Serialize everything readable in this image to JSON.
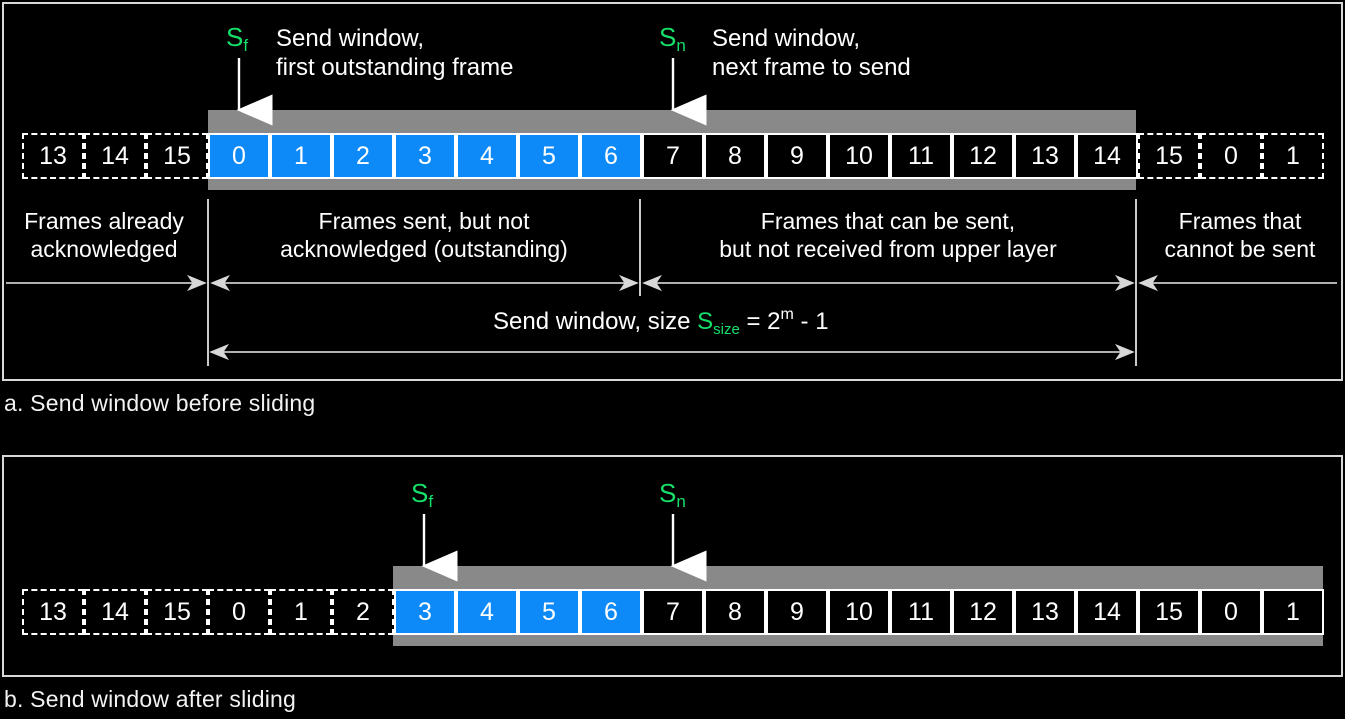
{
  "panels": [
    {
      "id": "a",
      "caption": "a. Send window before sliding",
      "pointers": [
        {
          "name": "Sf",
          "base": "S",
          "sub": "f",
          "text": "Send window,\nfirst outstanding frame"
        },
        {
          "name": "Sn",
          "base": "S",
          "sub": "n",
          "text": "Send window,\nnext frame to send"
        }
      ],
      "cells": [
        {
          "label": "13",
          "state": "acknowledged"
        },
        {
          "label": "14",
          "state": "acknowledged"
        },
        {
          "label": "15",
          "state": "acknowledged"
        },
        {
          "label": "0",
          "state": "outstanding"
        },
        {
          "label": "1",
          "state": "outstanding"
        },
        {
          "label": "2",
          "state": "outstanding"
        },
        {
          "label": "3",
          "state": "outstanding"
        },
        {
          "label": "4",
          "state": "outstanding"
        },
        {
          "label": "5",
          "state": "outstanding"
        },
        {
          "label": "6",
          "state": "outstanding"
        },
        {
          "label": "7",
          "state": "sendable"
        },
        {
          "label": "8",
          "state": "sendable"
        },
        {
          "label": "9",
          "state": "sendable"
        },
        {
          "label": "10",
          "state": "sendable"
        },
        {
          "label": "11",
          "state": "sendable"
        },
        {
          "label": "12",
          "state": "sendable"
        },
        {
          "label": "13",
          "state": "sendable"
        },
        {
          "label": "14",
          "state": "sendable"
        },
        {
          "label": "15",
          "state": "cannot-send"
        },
        {
          "label": "0",
          "state": "cannot-send"
        },
        {
          "label": "1",
          "state": "cannot-send"
        }
      ],
      "regions": [
        {
          "id": "acknowledged",
          "text": "Frames already\nacknowledged"
        },
        {
          "id": "outstanding",
          "text": "Frames sent, but not\nacknowledged (outstanding)"
        },
        {
          "id": "sendable",
          "text": "Frames that can be sent,\nbut not received from upper layer"
        },
        {
          "id": "cannot-send",
          "text": "Frames that\ncannot be sent"
        }
      ],
      "formula": {
        "prefix": "Send window, size ",
        "symbol_base": "S",
        "symbol_sub": "size",
        "equals": " = 2",
        "exponent": "m",
        "suffix": " - 1"
      }
    },
    {
      "id": "b",
      "caption": "b. Send window after sliding",
      "pointers": [
        {
          "name": "Sf",
          "base": "S",
          "sub": "f",
          "text": ""
        },
        {
          "name": "Sn",
          "base": "S",
          "sub": "n",
          "text": ""
        }
      ],
      "cells": [
        {
          "label": "13",
          "state": "acknowledged"
        },
        {
          "label": "14",
          "state": "acknowledged"
        },
        {
          "label": "15",
          "state": "acknowledged"
        },
        {
          "label": "0",
          "state": "acknowledged"
        },
        {
          "label": "1",
          "state": "acknowledged"
        },
        {
          "label": "2",
          "state": "acknowledged"
        },
        {
          "label": "3",
          "state": "outstanding"
        },
        {
          "label": "4",
          "state": "outstanding"
        },
        {
          "label": "5",
          "state": "outstanding"
        },
        {
          "label": "6",
          "state": "outstanding"
        },
        {
          "label": "7",
          "state": "sendable"
        },
        {
          "label": "8",
          "state": "sendable"
        },
        {
          "label": "9",
          "state": "sendable"
        },
        {
          "label": "10",
          "state": "sendable"
        },
        {
          "label": "11",
          "state": "sendable"
        },
        {
          "label": "12",
          "state": "sendable"
        },
        {
          "label": "13",
          "state": "sendable"
        },
        {
          "label": "14",
          "state": "sendable"
        },
        {
          "label": "15",
          "state": "sendable"
        },
        {
          "label": "0",
          "state": "sendable"
        },
        {
          "label": "1",
          "state": "sendable"
        }
      ]
    }
  ],
  "colors": {
    "background": "#000000",
    "frame_border": "#d8d8d8",
    "window_band": "#898989",
    "outstanding_fill": "#0d8af7",
    "pointer_label": "#14e06a",
    "text": "#ffffff"
  }
}
